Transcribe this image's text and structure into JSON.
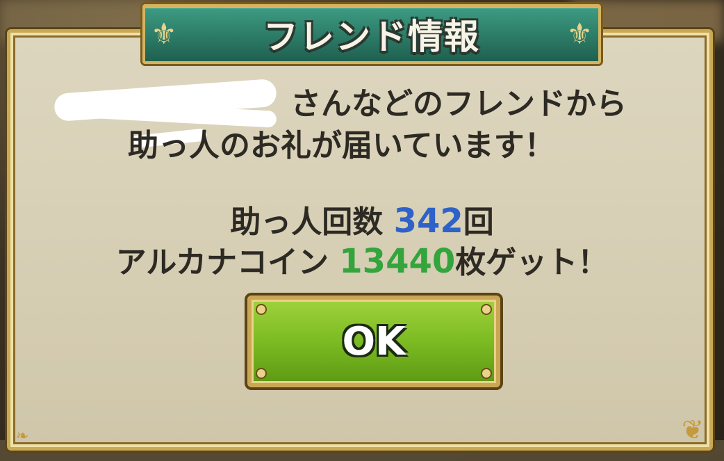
{
  "dialog": {
    "title": "フレンド情報",
    "line1_suffix": "さんなどのフレンドから",
    "line2": "助っ人のお礼が届いています！",
    "helper_count_label": "助っ人回数",
    "helper_count": "342",
    "helper_count_unit": "回",
    "coin_label": "アルカナコイン",
    "coin_amount": "13440",
    "coin_suffix": "枚ゲット！",
    "ok_label": "OK"
  },
  "colors": {
    "panel": "#d8d0b6",
    "title_banner": "#2c7b66",
    "gold_border": "#c9a955",
    "count_blue": "#2f62c8",
    "coin_green": "#34a43d",
    "ok_button": "#7cbb22"
  },
  "icons": {
    "title_ornament": "fleur-de-lis-icon",
    "panel_corner": "scroll-curl-icon"
  }
}
